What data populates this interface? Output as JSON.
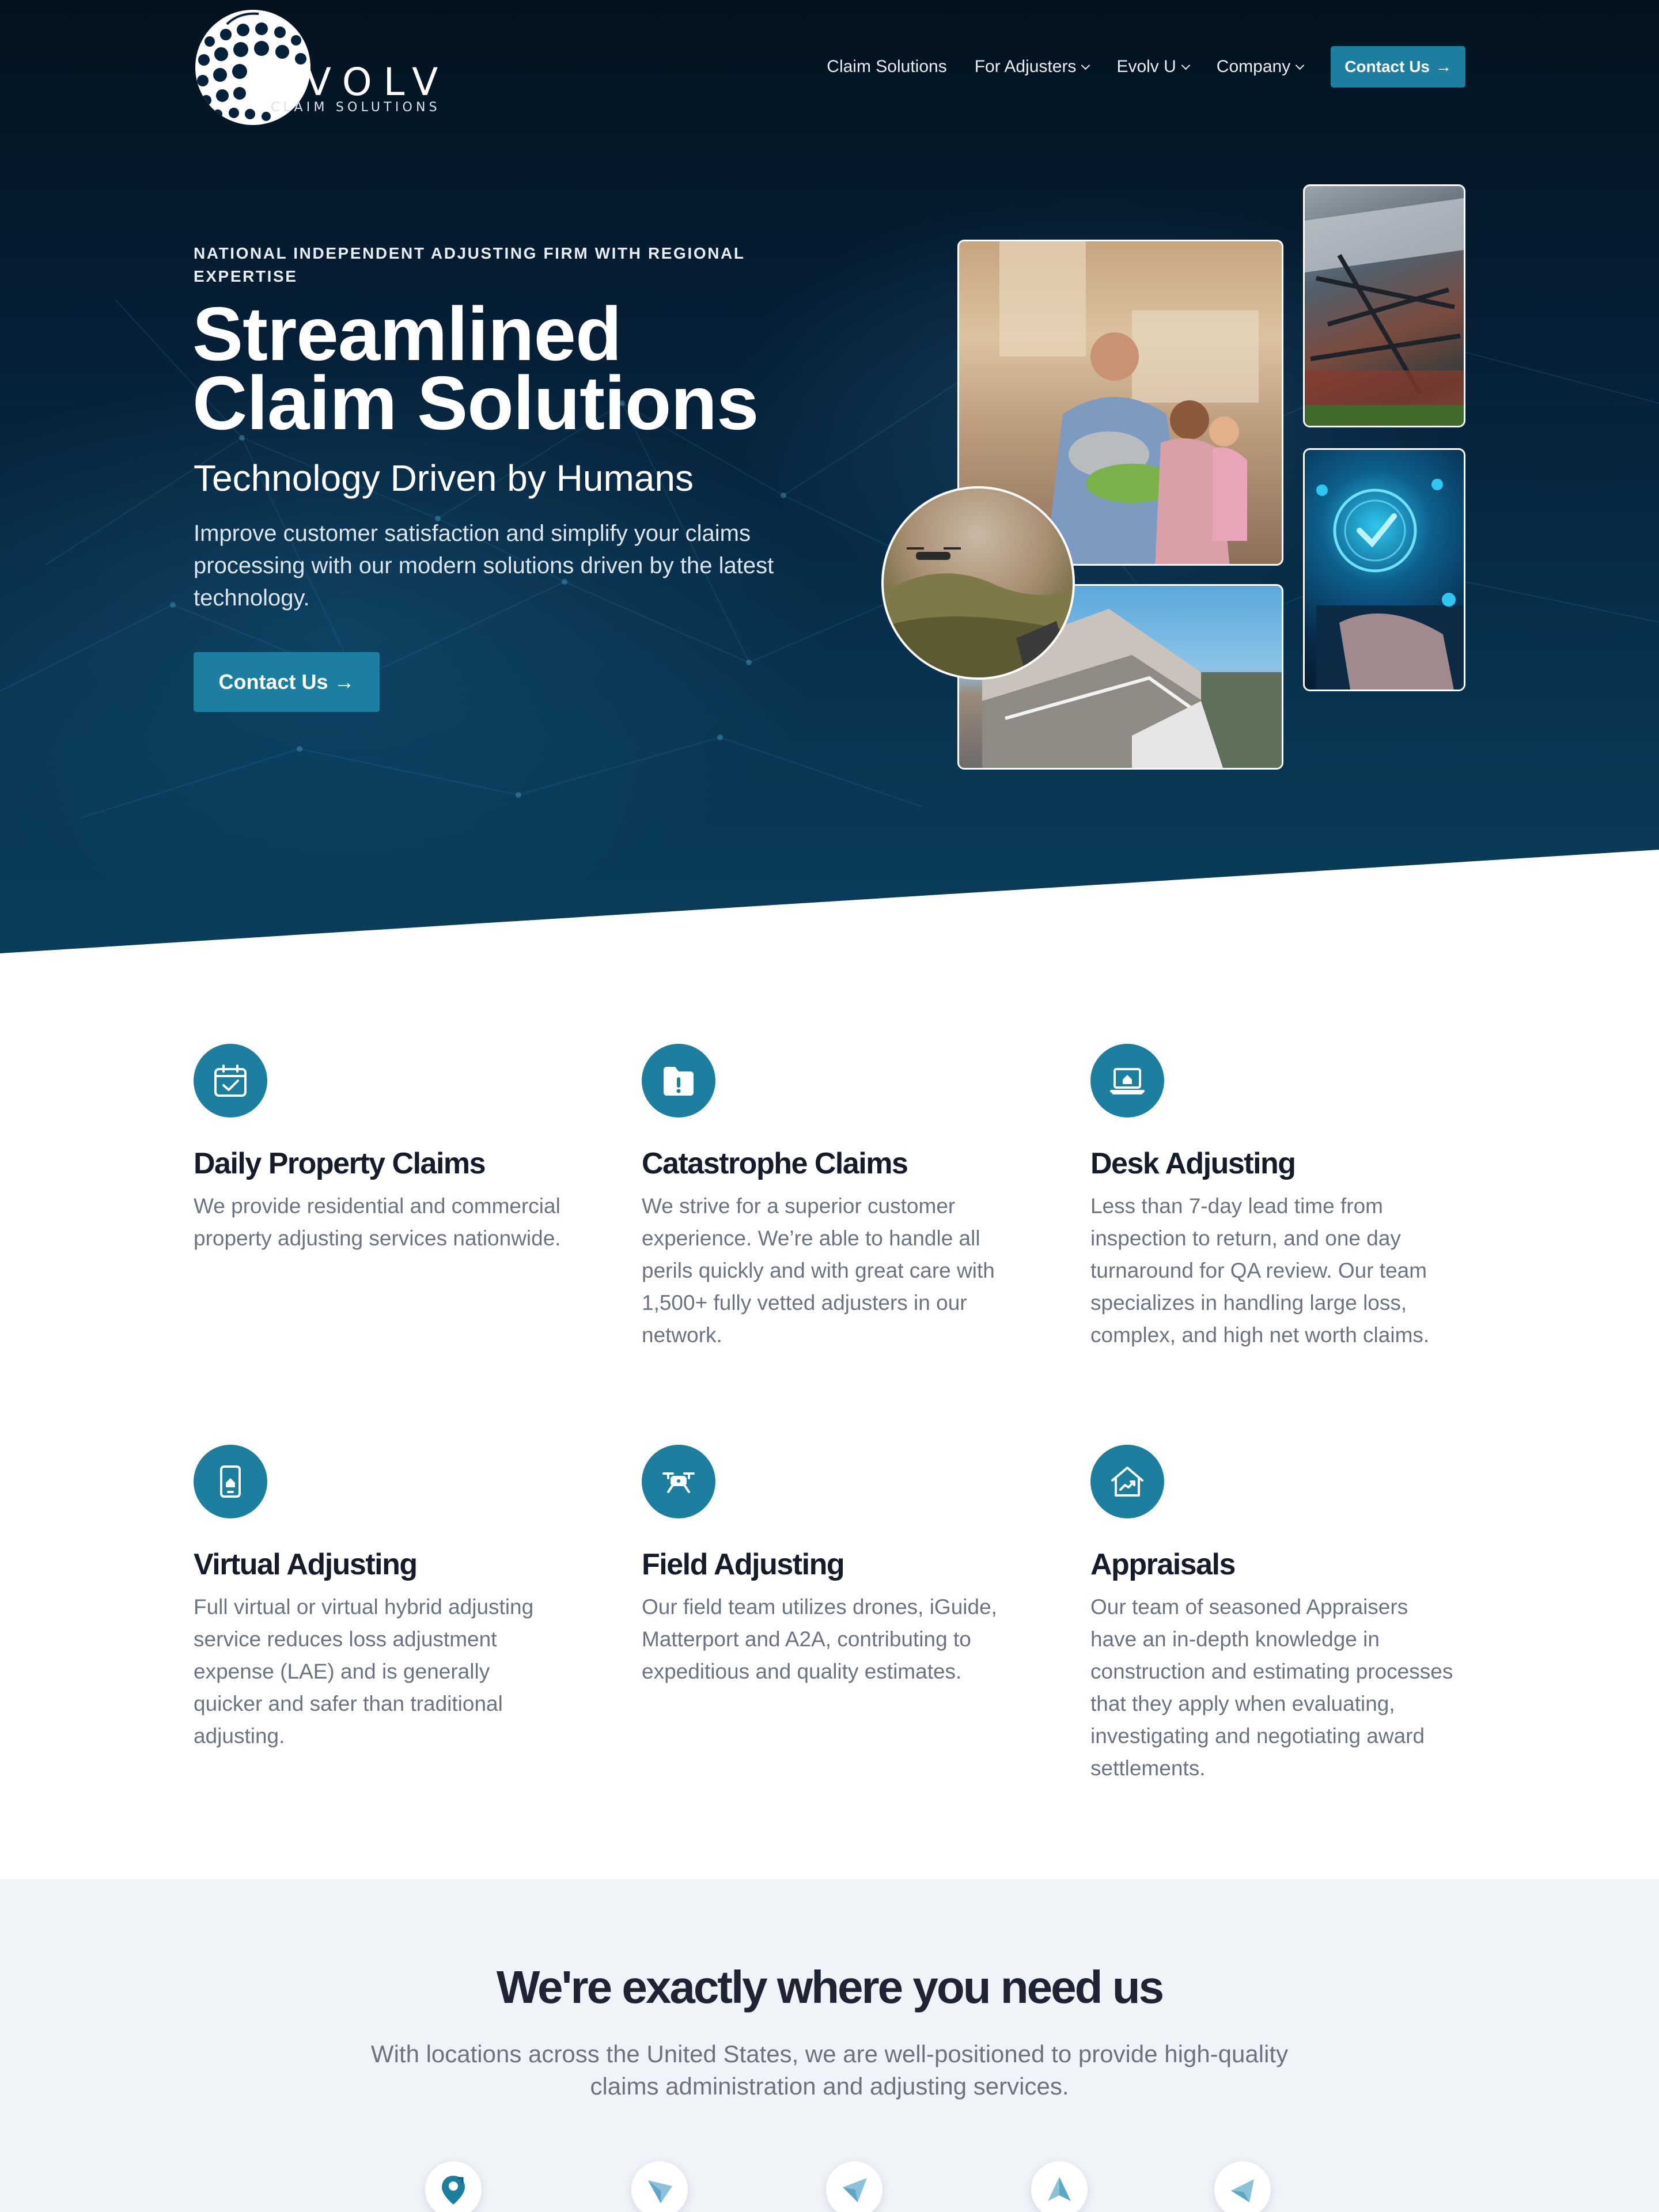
{
  "header": {
    "logo_word": "EVOLV",
    "logo_sub": "CLAIM SOLUTIONS",
    "nav": [
      {
        "label": "Claim Solutions",
        "has_dropdown": false
      },
      {
        "label": "For Adjusters",
        "has_dropdown": true
      },
      {
        "label": "Evolv U",
        "has_dropdown": true
      },
      {
        "label": "Company",
        "has_dropdown": true
      }
    ],
    "cta_label": "Contact Us"
  },
  "hero": {
    "eyebrow": "NATIONAL INDEPENDENT ADJUSTING FIRM WITH REGIONAL EXPERTISE",
    "title_line1": "Streamlined",
    "title_line2": "Claim Solutions",
    "tagline": "Technology Driven by Humans",
    "lead": "Improve customer satisfaction and simplify your claims processing with our modern solutions driven by the latest technology.",
    "cta_label": "Contact Us"
  },
  "services": [
    {
      "icon": "calendar-check-icon",
      "title": "Daily Property Claims",
      "desc": "We provide residential and commercial property adjusting services nationwide."
    },
    {
      "icon": "folder-alert-icon",
      "title": "Catastrophe Claims",
      "desc": "We strive for a superior customer experience. We’re able to handle all perils quickly and with great care with 1,500+ fully vetted adjusters in our network."
    },
    {
      "icon": "laptop-home-icon",
      "title": "Desk Adjusting",
      "desc": "Less than 7-day lead time from inspection to return, and one day turnaround for QA review. Our team specializes in handling large loss, complex, and high net worth claims."
    },
    {
      "icon": "tablet-home-icon",
      "title": "Virtual Adjusting",
      "desc": "Full virtual or virtual hybrid adjusting service reduces loss adjustment expense (LAE) and is generally quicker and safer than traditional adjusting."
    },
    {
      "icon": "drone-icon",
      "title": "Field Adjusting",
      "desc": "Our field team utilizes drones, iGuide, Matterport and A2A, contributing to expeditious and quality estimates."
    },
    {
      "icon": "house-chart-icon",
      "title": "Appraisals",
      "desc": "Our team of seasoned Appraisers have an in-depth knowledge in construction and estimating processes that they apply when evaluating, investigating and negotiating award settlements."
    }
  ],
  "locations": {
    "title": "We're exactly where you need us",
    "subtitle": "With locations across the United States, we are well-positioned to provide high-quality claims administration and adjusting services.",
    "markers": [
      "map-pin-icon",
      "navigation-arrow-icon",
      "navigation-arrow-icon",
      "navigation-arrow-icon",
      "navigation-arrow-icon"
    ]
  },
  "colors": {
    "accent": "#1c7f9f",
    "hero_bg": "#06213a",
    "heading": "#151b2a",
    "body_text": "#6b7280",
    "section_bg": "#f0f3f8"
  }
}
